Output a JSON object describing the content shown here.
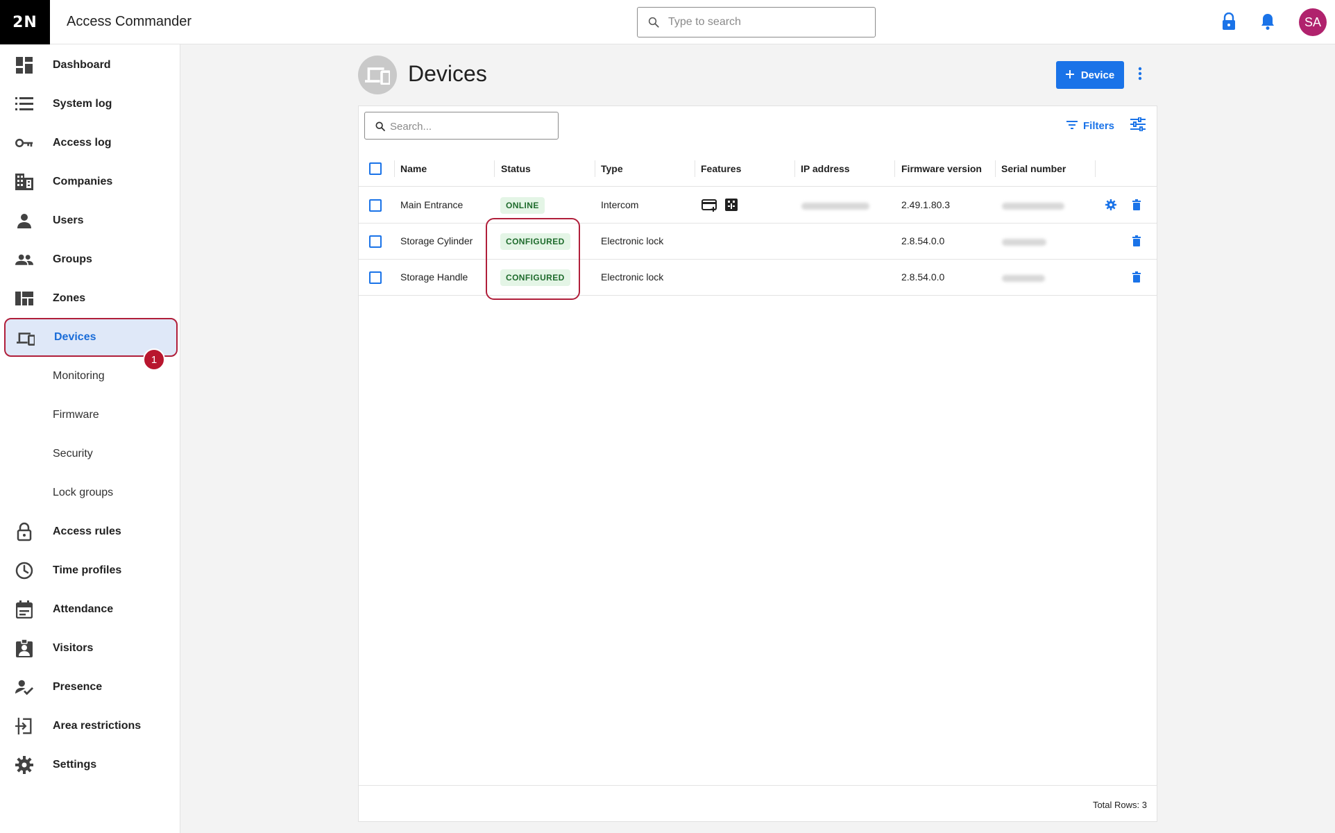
{
  "header": {
    "logo": "2N",
    "app_title": "Access Commander",
    "search_placeholder": "Type to search",
    "avatar_initials": "SA",
    "icons": [
      "lock-icon",
      "bell-icon"
    ]
  },
  "sidebar": {
    "items": [
      {
        "label": "Dashboard",
        "icon": "dashboard-icon"
      },
      {
        "label": "System log",
        "icon": "list-icon"
      },
      {
        "label": "Access log",
        "icon": "key-icon"
      },
      {
        "label": "Companies",
        "icon": "building-icon"
      },
      {
        "label": "Users",
        "icon": "user-icon"
      },
      {
        "label": "Groups",
        "icon": "group-icon"
      },
      {
        "label": "Zones",
        "icon": "zones-icon"
      },
      {
        "label": "Devices",
        "icon": "devices-icon",
        "active": true
      },
      {
        "label": "Monitoring"
      },
      {
        "label": "Firmware"
      },
      {
        "label": "Security"
      },
      {
        "label": "Lock groups"
      },
      {
        "label": "Access rules",
        "icon": "lock-outline-icon"
      },
      {
        "label": "Time profiles",
        "icon": "clock-icon"
      },
      {
        "label": "Attendance",
        "icon": "calendar-icon"
      },
      {
        "label": "Visitors",
        "icon": "visitor-badge-icon"
      },
      {
        "label": "Presence",
        "icon": "presence-icon"
      },
      {
        "label": "Area restrictions",
        "icon": "area-icon"
      },
      {
        "label": "Settings",
        "icon": "gear-icon"
      }
    ],
    "badge": "1"
  },
  "page": {
    "title": "Devices",
    "add_button": "Device",
    "search_placeholder": "Search...",
    "filters_label": "Filters"
  },
  "table": {
    "columns": [
      "Name",
      "Status",
      "Type",
      "Features",
      "IP address",
      "Firmware version",
      "Serial number"
    ],
    "rows": [
      {
        "name": "Main Entrance",
        "status": "ONLINE",
        "type": "Intercom",
        "firmware": "2.49.1.80.3"
      },
      {
        "name": "Storage Cylinder",
        "status": "CONFIGURED",
        "type": "Electronic lock",
        "firmware": "2.8.54.0.0"
      },
      {
        "name": "Storage Handle",
        "status": "CONFIGURED",
        "type": "Electronic lock",
        "firmware": "2.8.54.0.0"
      }
    ],
    "total_rows": "Total Rows: 3"
  },
  "colors": {
    "accent": "#1a73e8",
    "highlight": "#b01e3a",
    "status_green_bg": "#e4f5e6",
    "status_green_text": "#1e6b2c",
    "avatar": "#b0226d"
  }
}
